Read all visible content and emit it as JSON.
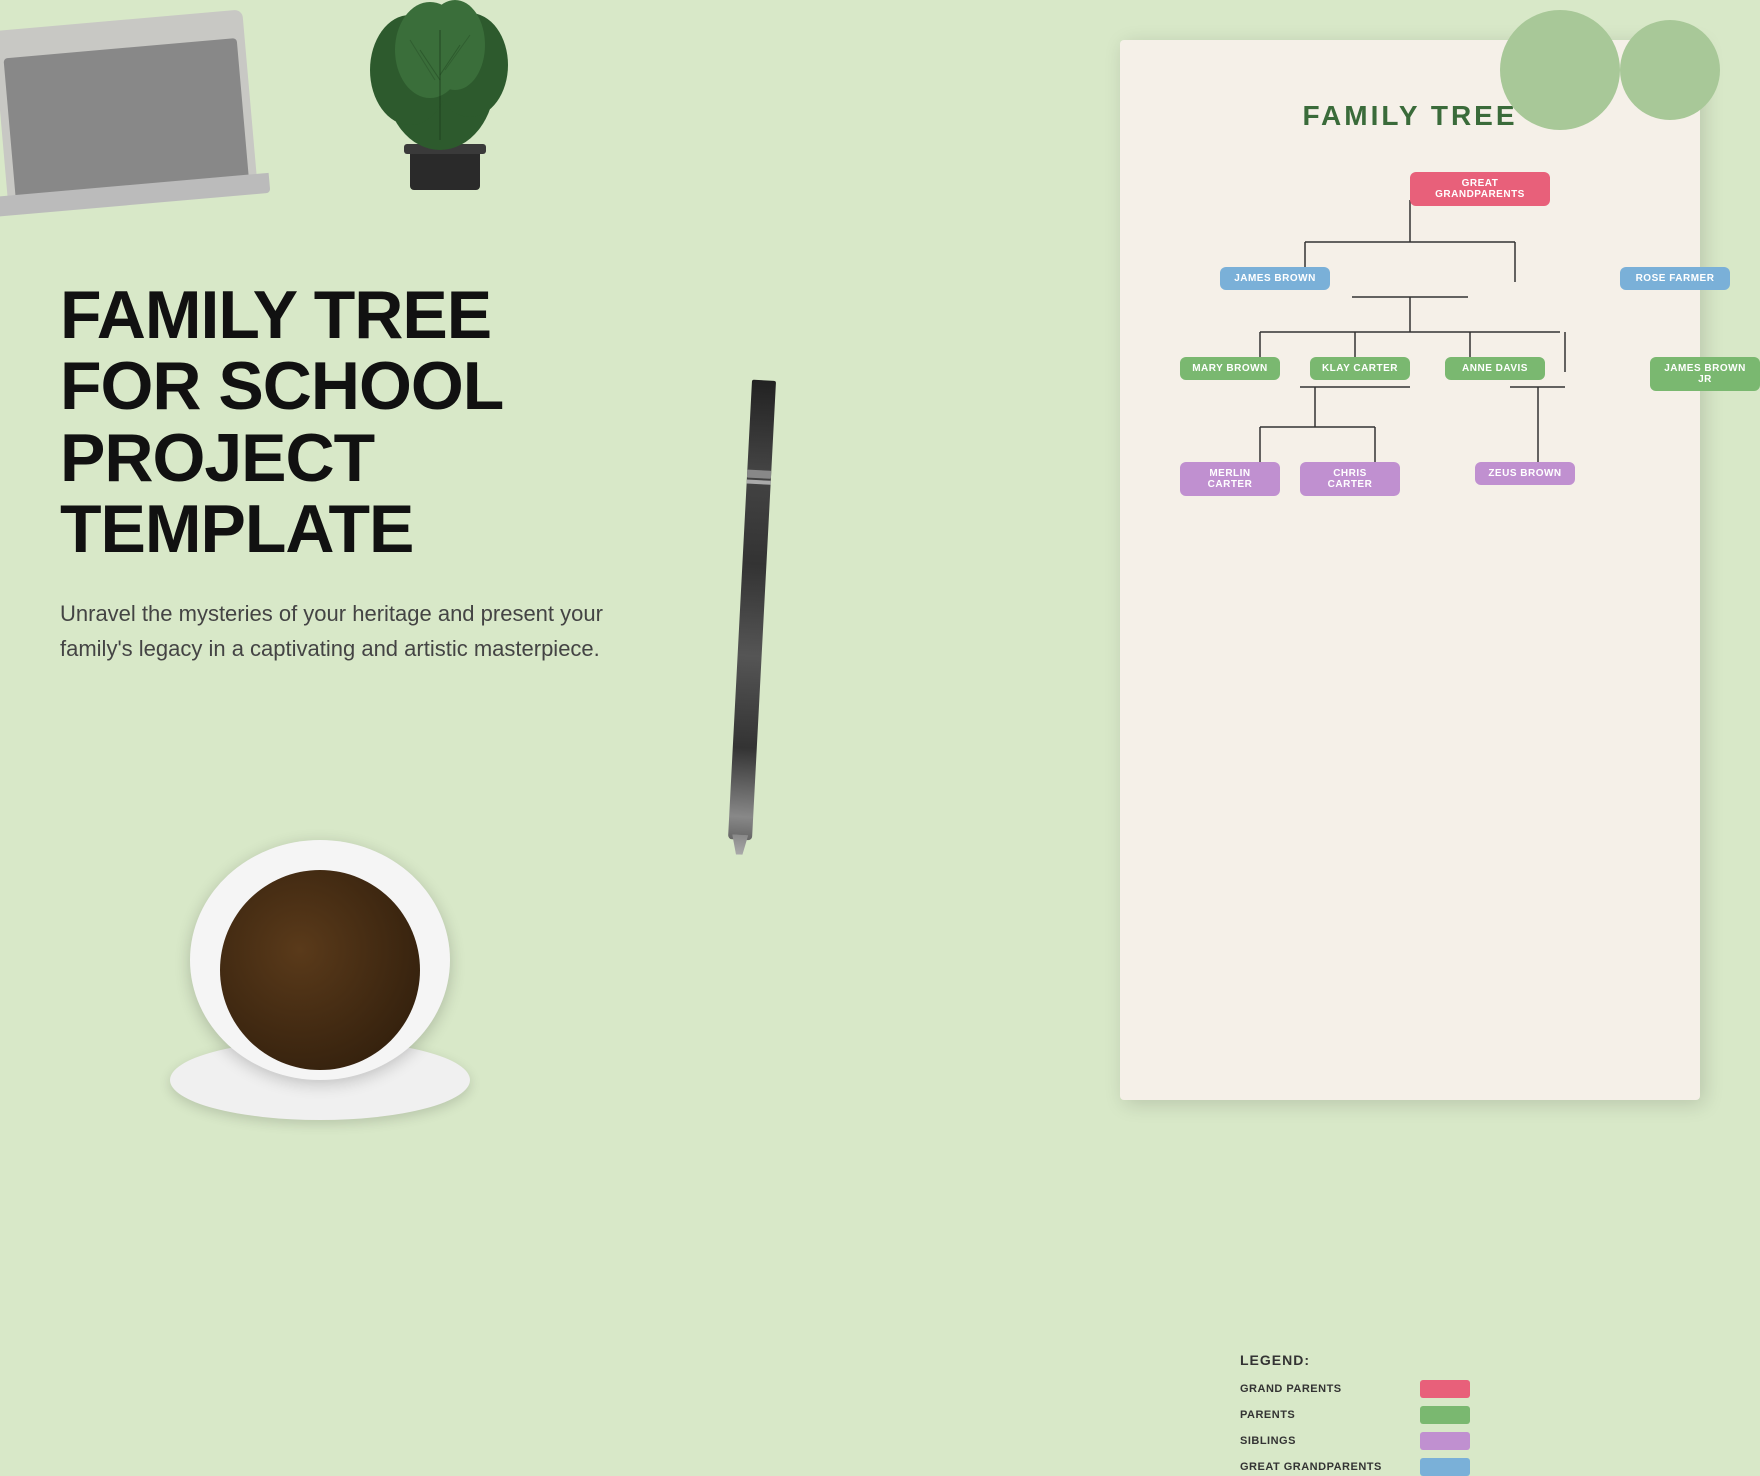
{
  "page": {
    "background_left": "#ebebeb",
    "background_right": "#d8e8c8"
  },
  "main_text": {
    "title": "FAMILY TREE\nFOR SCHOOL\nPROJECT TEMPLATE",
    "subtitle": "Unravel the mysteries of your heritage and present your family's legacy in a captivating and artistic masterpiece."
  },
  "document": {
    "title": "FAMILY TREE",
    "nodes": {
      "great_grandparents": "GREAT GRANDPARENTS",
      "james_brown": "JAMES BROWN",
      "rose_farmer": "ROSE FARMER",
      "mary_brown": "MARY BROWN",
      "klay_carter": "KLAY CARTER",
      "anne_davis": "ANNE DAVIS",
      "james_brown_jr": "JAMES BROWN JR",
      "merlin_carter": "MERLIN CARTER",
      "chris_carter": "CHRIS CARTER",
      "zeus_brown": "ZEUS BROWN"
    },
    "legend": {
      "title": "LEGEND:",
      "items": [
        {
          "label": "GRAND PARENTS",
          "color": "#e8607a"
        },
        {
          "label": "PARENTS",
          "color": "#7ab870"
        },
        {
          "label": "SIBLINGS",
          "color": "#c090d0"
        },
        {
          "label": "GREAT GRANDPARENTS",
          "color": "#7ab0d8"
        }
      ]
    }
  }
}
